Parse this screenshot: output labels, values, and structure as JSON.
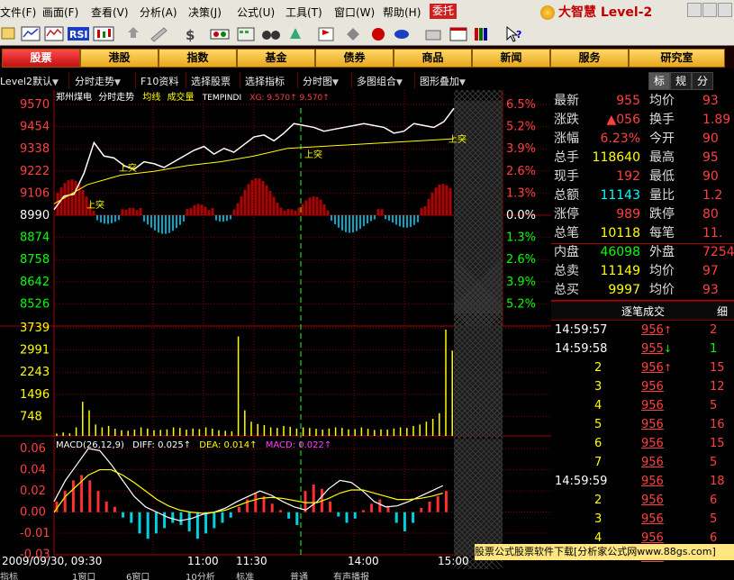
{
  "menu": [
    "文件(F)",
    "画面(F)",
    "查看(V)",
    "分析(A)",
    "决策(J)",
    "公式(U)",
    "工具(T)",
    "窗口(W)",
    "帮助(H)"
  ],
  "entrust_label": "委托",
  "brand": "大智慧 Level-2",
  "toolbar_icons": [
    "open-icon",
    "trend-icon",
    "chart-icon",
    "rsi-icon",
    "candle-icon",
    "arrow-icon",
    "pen-icon",
    "money-icon",
    "bar-icon",
    "calendar-icon",
    "binoculars-icon",
    "alert-icon",
    "flag-icon",
    "diamond-icon",
    "sword-icon",
    "eye-icon",
    "print-icon",
    "window-icon",
    "books-icon",
    "help-icon"
  ],
  "rsi_label": "RSI",
  "nav": [
    "股票",
    "港股",
    "指数",
    "基金",
    "债券",
    "商品",
    "新闻",
    "服务",
    "研究室"
  ],
  "subtabs": [
    "Level2默认",
    "分时走势",
    "F10资料",
    "选择股票",
    "选择指标",
    "分时图",
    "多图组合",
    "图形叠加"
  ],
  "chart_header": {
    "stock": "郑州煤电",
    "mode": "分时走势",
    "avg_label": "均线",
    "vol_label": "成交量",
    "formula": "TEMPINDI",
    "xg_label": "XG: 9.570↑ 9.570↑"
  },
  "macd_header": {
    "name": "MACD(26,12,9)",
    "diff": "DIFF: 0.025↑",
    "dea": "DEA: 0.014↑",
    "macd": "MACD: 0.022↑"
  },
  "signal_label": "上突",
  "right_panel": {
    "tabs": [
      "标",
      "规",
      "分"
    ],
    "quote": [
      {
        "l1": "最新",
        "v1": "955",
        "c1": "#ff4040",
        "l2": "均价",
        "v2": "93"
      },
      {
        "l1": "涨跌",
        "v1": "▲056",
        "c1": "#ff4040",
        "l2": "换手",
        "v2": "1.89"
      },
      {
        "l1": "涨幅",
        "v1": "6.23%",
        "c1": "#ff4040",
        "l2": "今开",
        "v2": "90"
      },
      {
        "l1": "总手",
        "v1": "118640",
        "c1": "#ffff00",
        "l2": "最高",
        "v2": "95"
      },
      {
        "l1": "现手",
        "v1": "192",
        "c1": "#ff4040",
        "l2": "最低",
        "v2": "90"
      },
      {
        "l1": "总额",
        "v1": "11143",
        "c1": "#00ffff",
        "l2": "量比",
        "v2": "1.2"
      },
      {
        "l1": "涨停",
        "v1": "989",
        "c1": "#ff4040",
        "l2": "跌停",
        "v2": "80"
      },
      {
        "l1": "总笔",
        "v1": "10118",
        "c1": "#ffff00",
        "l2": "每笔",
        "v2": "11."
      },
      {
        "l1": "内盘",
        "v1": "46098",
        "c1": "#00ff00",
        "l2": "外盘",
        "v2": "7254"
      },
      {
        "l1": "总卖",
        "v1": "11149",
        "c1": "#ffff00",
        "l2": "均价",
        "v2": "97"
      },
      {
        "l1": "总买",
        "v1": "9997",
        "c1": "#ffff00",
        "l2": "均价",
        "v2": "93"
      }
    ],
    "tick_title": "逐笔成交",
    "tick_tab": "细",
    "ticks": [
      {
        "t": "14:59:57",
        "p": "956",
        "a": "↑",
        "v": "2"
      },
      {
        "t": "14:59:58",
        "p": "955",
        "a": "↓",
        "v": "1"
      },
      {
        "t": "2",
        "p": "956",
        "a": "↑",
        "v": "15"
      },
      {
        "t": "3",
        "p": "956",
        "a": "",
        "v": "12"
      },
      {
        "t": "4",
        "p": "956",
        "a": "",
        "v": "5"
      },
      {
        "t": "5",
        "p": "956",
        "a": "",
        "v": "16"
      },
      {
        "t": "6",
        "p": "956",
        "a": "",
        "v": "15"
      },
      {
        "t": "7",
        "p": "956",
        "a": "",
        "v": "5"
      },
      {
        "t": "14:59:59",
        "p": "956",
        "a": "",
        "v": "18"
      },
      {
        "t": "2",
        "p": "956",
        "a": "",
        "v": "6"
      },
      {
        "t": "3",
        "p": "956",
        "a": "",
        "v": "5"
      },
      {
        "t": "4",
        "p": "956",
        "a": "",
        "v": "6"
      },
      {
        "t": "5",
        "p": "956",
        "a": "",
        "v": "2"
      }
    ]
  },
  "ad_text": "股票公式股票软件下载[分析家公式网www.88gs.com]",
  "bottom_tabs": [
    "指标",
    "1窗口",
    "6窗口",
    "10分析",
    "标准",
    "普通",
    "有声播报"
  ],
  "chart_data": {
    "type": "line",
    "price_axis": {
      "ticks": [
        9570,
        9454,
        9338,
        9222,
        9106,
        8990,
        8874,
        8758,
        8642,
        8526
      ],
      "prev_close": 8990
    },
    "pct_axis": [
      "6.5%",
      "5.2%",
      "3.9%",
      "2.6%",
      "1.3%",
      "0.0%",
      "1.3%",
      "2.6%",
      "3.9%",
      "5.2%"
    ],
    "volume_axis": {
      "ticks": [
        3739,
        2991,
        2243,
        1496,
        748
      ]
    },
    "macd_axis": {
      "ticks": [
        "0.06",
        "0.04",
        "0.02",
        "0.00",
        "-0.01",
        "-0.03"
      ],
      "ylim": [
        -0.035,
        0.065
      ]
    },
    "time_labels": [
      "2009/09/30, 09:30",
      "11:00",
      "11:30",
      "14:00",
      "15:00"
    ],
    "price_series": {
      "name": "分时走势",
      "x": [
        0,
        6,
        12,
        18,
        24,
        30,
        36,
        42,
        48,
        54,
        60,
        66,
        72,
        78,
        84,
        90,
        96,
        102,
        108,
        114,
        120,
        126,
        132,
        138,
        144,
        150,
        156,
        162,
        168,
        174,
        180,
        186,
        192,
        198,
        204,
        210,
        216,
        222,
        228,
        234,
        240
      ],
      "values": [
        9020,
        9090,
        9100,
        9210,
        9370,
        9300,
        9290,
        9250,
        9230,
        9270,
        9260,
        9240,
        9270,
        9300,
        9330,
        9350,
        9310,
        9340,
        9320,
        9360,
        9400,
        9410,
        9380,
        9420,
        9470,
        9460,
        9450,
        9430,
        9440,
        9450,
        9460,
        9470,
        9460,
        9450,
        9420,
        9430,
        9470,
        9460,
        9450,
        9480,
        9550
      ]
    },
    "avg_series": {
      "name": "均线",
      "x": [
        0,
        20,
        40,
        60,
        80,
        100,
        120,
        140,
        160,
        180,
        200,
        220,
        240
      ],
      "values": [
        9050,
        9150,
        9200,
        9220,
        9250,
        9270,
        9300,
        9340,
        9350,
        9360,
        9370,
        9380,
        9390
      ]
    },
    "volume": [
      80,
      120,
      90,
      300,
      1200,
      900,
      400,
      300,
      350,
      250,
      200,
      180,
      220,
      300,
      260,
      200,
      210,
      230,
      300,
      280,
      220,
      260,
      240,
      300,
      250,
      200,
      180,
      160,
      3500,
      900,
      500,
      420,
      380,
      300,
      280,
      350,
      320,
      260,
      300,
      280,
      250,
      220,
      260,
      300,
      280,
      230,
      240,
      300,
      250,
      210,
      230,
      220,
      260,
      300,
      280,
      350,
      400,
      500,
      600,
      800,
      3739,
      3000
    ],
    "macd_hist": [
      0.01,
      0.02,
      0.03,
      0.035,
      0.03,
      0.02,
      0.01,
      0.005,
      -0.005,
      -0.01,
      -0.02,
      -0.025,
      -0.02,
      -0.015,
      -0.01,
      -0.012,
      -0.018,
      -0.025,
      -0.02,
      -0.015,
      -0.01,
      -0.005,
      0.005,
      0.012,
      0.018,
      0.015,
      0.008,
      0.002,
      -0.006,
      -0.012,
      0.02,
      0.026,
      0.022,
      0.01,
      -0.004,
      -0.01,
      -0.006,
      0.002,
      0.008,
      0.012,
      0.006,
      -0.01,
      -0.018,
      -0.01,
      0.004,
      0.01,
      0.015,
      0.02
    ],
    "diff_series": [
      0.01,
      0.03,
      0.045,
      0.06,
      0.058,
      0.045,
      0.03,
      0.015,
      0.005,
      0.0,
      -0.005,
      -0.008,
      -0.006,
      -0.002,
      0.0,
      0.004,
      0.01,
      0.015,
      0.02,
      0.016,
      0.01,
      0.005,
      0.002,
      0.01,
      0.022,
      0.03,
      0.028,
      0.02,
      0.01,
      0.005,
      0.006,
      0.01,
      0.015,
      0.02,
      0.025
    ],
    "dea_series": [
      0.0,
      0.015,
      0.025,
      0.035,
      0.04,
      0.04,
      0.035,
      0.028,
      0.02,
      0.012,
      0.006,
      0.002,
      0.0,
      -0.001,
      0.0,
      0.002,
      0.006,
      0.01,
      0.013,
      0.014,
      0.013,
      0.011,
      0.009,
      0.009,
      0.013,
      0.018,
      0.021,
      0.021,
      0.018,
      0.015,
      0.012,
      0.012,
      0.013,
      0.015,
      0.018
    ]
  }
}
